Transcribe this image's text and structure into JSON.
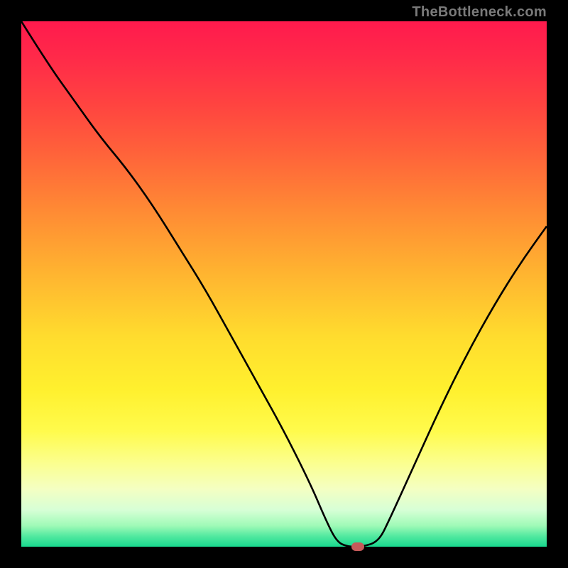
{
  "watermark": "TheBottleneck.com",
  "chart_data": {
    "type": "line",
    "title": "",
    "xlabel": "",
    "ylabel": "",
    "xlim": [
      0,
      100
    ],
    "ylim": [
      0,
      100
    ],
    "curve_points": [
      {
        "x": 0,
        "y": 100
      },
      {
        "x": 5,
        "y": 92
      },
      {
        "x": 10,
        "y": 85
      },
      {
        "x": 15,
        "y": 78
      },
      {
        "x": 20,
        "y": 72
      },
      {
        "x": 25,
        "y": 65
      },
      {
        "x": 30,
        "y": 57
      },
      {
        "x": 35,
        "y": 49
      },
      {
        "x": 40,
        "y": 40
      },
      {
        "x": 45,
        "y": 31
      },
      {
        "x": 50,
        "y": 22
      },
      {
        "x": 55,
        "y": 12
      },
      {
        "x": 58,
        "y": 5
      },
      {
        "x": 60,
        "y": 1
      },
      {
        "x": 62,
        "y": 0
      },
      {
        "x": 65,
        "y": 0
      },
      {
        "x": 68,
        "y": 1
      },
      {
        "x": 70,
        "y": 5
      },
      {
        "x": 75,
        "y": 16
      },
      {
        "x": 80,
        "y": 27
      },
      {
        "x": 85,
        "y": 37
      },
      {
        "x": 90,
        "y": 46
      },
      {
        "x": 95,
        "y": 54
      },
      {
        "x": 100,
        "y": 61
      }
    ],
    "marker": {
      "x": 64,
      "y": 0,
      "color": "#c65a5a"
    },
    "gradient_stops": [
      {
        "pos": 0,
        "color": "#ff1a4d"
      },
      {
        "pos": 50,
        "color": "#ffd030"
      },
      {
        "pos": 100,
        "color": "#18d88e"
      }
    ]
  }
}
